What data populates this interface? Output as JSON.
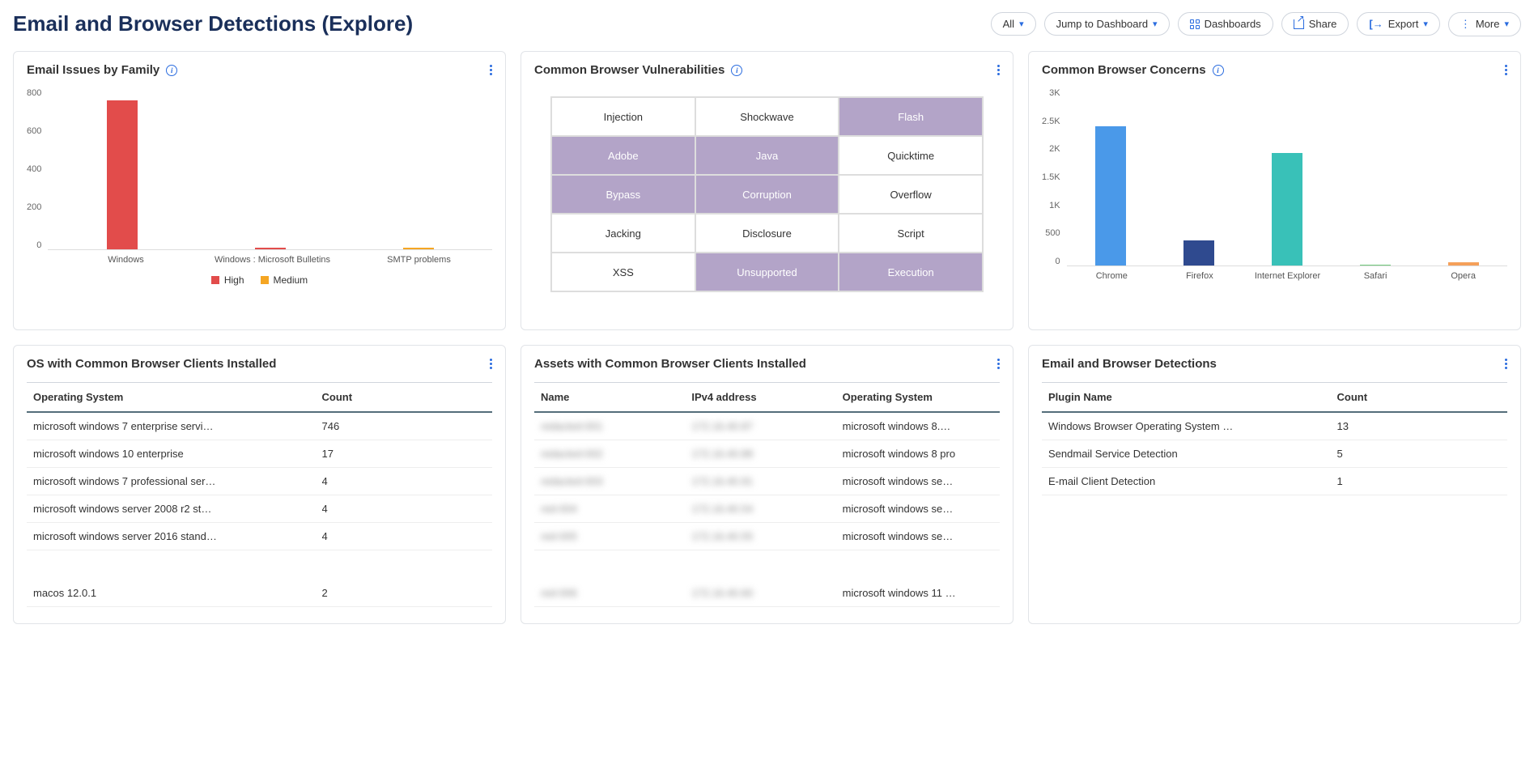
{
  "header": {
    "title": "Email and Browser Detections (Explore)",
    "actions": {
      "all": "All",
      "jump": "Jump to Dashboard",
      "dashboards": "Dashboards",
      "share": "Share",
      "export": "Export",
      "more": "More"
    }
  },
  "cards": {
    "emailIssues": {
      "title": "Email Issues by Family"
    },
    "vuln": {
      "title": "Common Browser Vulnerabilities"
    },
    "concerns": {
      "title": "Common Browser Concerns"
    },
    "osClients": {
      "title": "OS with Common Browser Clients Installed",
      "cols": {
        "os": "Operating System",
        "count": "Count"
      }
    },
    "assets": {
      "title": "Assets with Common Browser Clients Installed",
      "cols": {
        "name": "Name",
        "ip": "IPv4 address",
        "os": "Operating System"
      }
    },
    "detections": {
      "title": "Email and Browser Detections",
      "cols": {
        "plugin": "Plugin Name",
        "count": "Count"
      }
    }
  },
  "chart_data": [
    {
      "id": "emailIssues",
      "type": "bar",
      "categories": [
        "Windows",
        "Windows : Microsoft Bulletins",
        "SMTP problems"
      ],
      "series": [
        {
          "name": "High",
          "color": "#e24c4b",
          "values": [
            740,
            10,
            0
          ]
        },
        {
          "name": "Medium",
          "color": "#f5a623",
          "values": [
            0,
            0,
            10
          ]
        }
      ],
      "ylim": [
        0,
        800
      ],
      "yticks": [
        "800",
        "600",
        "400",
        "200",
        "0"
      ],
      "legend": [
        "High",
        "Medium"
      ]
    },
    {
      "id": "vulnerabilities",
      "type": "heatmap",
      "grid": [
        [
          {
            "label": "Injection",
            "on": false
          },
          {
            "label": "Shockwave",
            "on": false
          },
          {
            "label": "Flash",
            "on": true
          }
        ],
        [
          {
            "label": "Adobe",
            "on": true
          },
          {
            "label": "Java",
            "on": true
          },
          {
            "label": "Quicktime",
            "on": false
          }
        ],
        [
          {
            "label": "Bypass",
            "on": true
          },
          {
            "label": "Corruption",
            "on": true
          },
          {
            "label": "Overflow",
            "on": false
          }
        ],
        [
          {
            "label": "Jacking",
            "on": false
          },
          {
            "label": "Disclosure",
            "on": false
          },
          {
            "label": "Script",
            "on": false
          }
        ],
        [
          {
            "label": "XSS",
            "on": false
          },
          {
            "label": "Unsupported",
            "on": true
          },
          {
            "label": "Execution",
            "on": true
          }
        ]
      ]
    },
    {
      "id": "concerns",
      "type": "bar",
      "categories": [
        "Chrome",
        "Firefox",
        "Internet Explorer",
        "Safari",
        "Opera"
      ],
      "values": [
        2350,
        420,
        1900,
        20,
        60
      ],
      "colors": [
        "#4a99e9",
        "#2f4a8f",
        "#39c1b8",
        "#6fc97a",
        "#f5a05a"
      ],
      "ylim": [
        0,
        3000
      ],
      "yticks": [
        "3K",
        "2.5K",
        "2K",
        "1.5K",
        "1K",
        "500",
        "0"
      ]
    }
  ],
  "tables": {
    "osClients": [
      {
        "os": "microsoft windows 7 enterprise servi…",
        "count": "746"
      },
      {
        "os": "microsoft windows 10 enterprise",
        "count": "17"
      },
      {
        "os": "microsoft windows 7 professional ser…",
        "count": "4"
      },
      {
        "os": "microsoft windows server 2008 r2 st…",
        "count": "4"
      },
      {
        "os": "microsoft windows server 2016 stand…",
        "count": "4"
      },
      {
        "os": "",
        "count": ""
      },
      {
        "os": "",
        "count": ""
      },
      {
        "os": "macos 12.0.1",
        "count": "2"
      }
    ],
    "assets": [
      {
        "name": "redacted-001",
        "ip": "172.16.40.87",
        "os": "microsoft windows 8.…"
      },
      {
        "name": "redacted-002",
        "ip": "172.16.40.88",
        "os": "microsoft windows 8 pro"
      },
      {
        "name": "redacted-003",
        "ip": "172.16.40.91",
        "os": "microsoft windows se…"
      },
      {
        "name": "red-004",
        "ip": "172.16.40.54",
        "os": "microsoft windows se…"
      },
      {
        "name": "red-005",
        "ip": "172.16.40.55",
        "os": "microsoft windows se…"
      },
      {
        "name": "",
        "ip": "",
        "os": ""
      },
      {
        "name": "",
        "ip": "",
        "os": ""
      },
      {
        "name": "red-006",
        "ip": "172.16.40.60",
        "os": "microsoft windows 11 …"
      }
    ],
    "detections": [
      {
        "plugin": "Windows Browser Operating System …",
        "count": "13"
      },
      {
        "plugin": "Sendmail Service Detection",
        "count": "5"
      },
      {
        "plugin": "E-mail Client Detection",
        "count": "1"
      }
    ]
  }
}
